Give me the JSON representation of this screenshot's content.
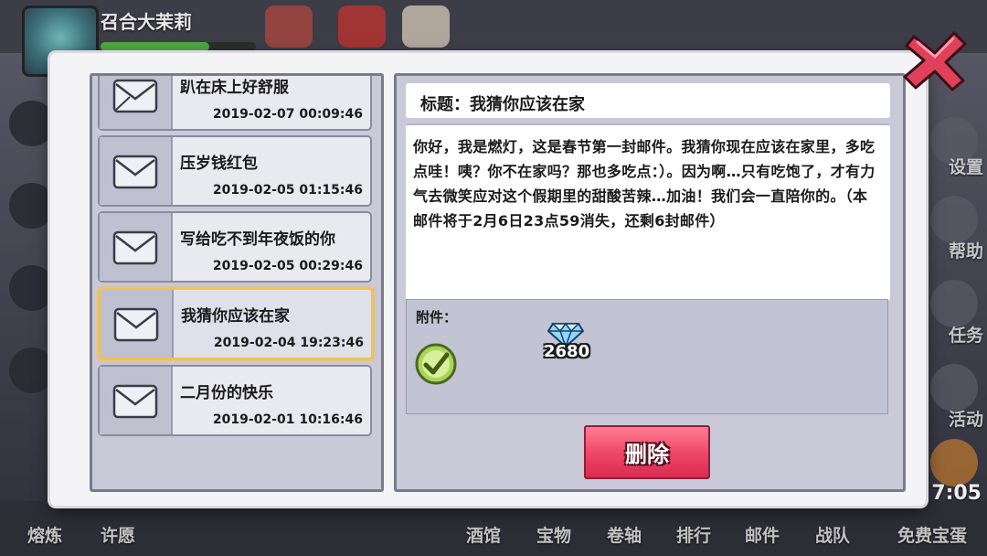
{
  "player": {
    "name": "召合大茉莉"
  },
  "time": "7:05",
  "right_sidebar": [
    "设置",
    "帮助",
    "任务",
    "活动"
  ],
  "bottom_nav": [
    "熔炼",
    "许愿",
    "酒馆",
    "宝物",
    "卷轴",
    "排行",
    "邮件",
    "战队",
    "免费宝蛋"
  ],
  "mail_list": [
    {
      "title": "趴在床上好舒服",
      "date": "2019-02-07 00:09:46",
      "selected": false
    },
    {
      "title": "压岁钱红包",
      "date": "2019-02-05 01:15:46",
      "selected": false
    },
    {
      "title": "写给吃不到年夜饭的你",
      "date": "2019-02-05 00:29:46",
      "selected": false
    },
    {
      "title": "我猜你应该在家",
      "date": "2019-02-04 19:23:46",
      "selected": true
    },
    {
      "title": "二月份的快乐",
      "date": "2019-02-01 10:16:46",
      "selected": false
    }
  ],
  "detail": {
    "subject": "标题：我猜你应该在家",
    "body": "你好，我是燃灯，这是春节第一封邮件。我猜你现在应该在家里，多吃点哇！咦？你不在家吗？那也多吃点：）。因为啊…只有吃饱了，才有力气去微笑应对这个假期里的甜酸苦辣…加油！我们会一直陪你的。（本邮件将于2月6日23点59消失，还剩6封邮件）",
    "attachment_label": "附件：",
    "attachment_count": "2680",
    "delete_label": "删除"
  },
  "colors": {
    "accent_selected": "#f2c24a",
    "delete_button": "#ee4466",
    "close_x": "#e0405a"
  }
}
